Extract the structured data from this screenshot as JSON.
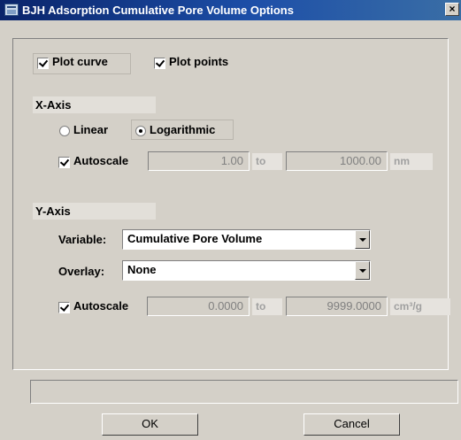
{
  "window": {
    "title": "BJH Adsorption Cumulative Pore Volume Options",
    "close": "×"
  },
  "plot": {
    "curve_label": "Plot curve",
    "curve_checked": true,
    "points_label": "Plot points",
    "points_checked": true
  },
  "x_axis": {
    "section_label": "X-Axis",
    "linear_label": "Linear",
    "log_label": "Logarithmic",
    "selected": "Logarithmic",
    "autoscale_label": "Autoscale",
    "autoscale_checked": true,
    "min": "1.00",
    "to": "to",
    "max": "1000.00",
    "unit": "nm"
  },
  "y_axis": {
    "section_label": "Y-Axis",
    "variable_label": "Variable:",
    "variable_value": "Cumulative Pore Volume",
    "overlay_label": "Overlay:",
    "overlay_value": "None",
    "autoscale_label": "Autoscale",
    "autoscale_checked": true,
    "min": "0.0000",
    "to": "to",
    "max": "9999.0000",
    "unit": "cm³/g"
  },
  "status_text": "",
  "buttons": {
    "ok": "OK",
    "cancel": "Cancel"
  }
}
